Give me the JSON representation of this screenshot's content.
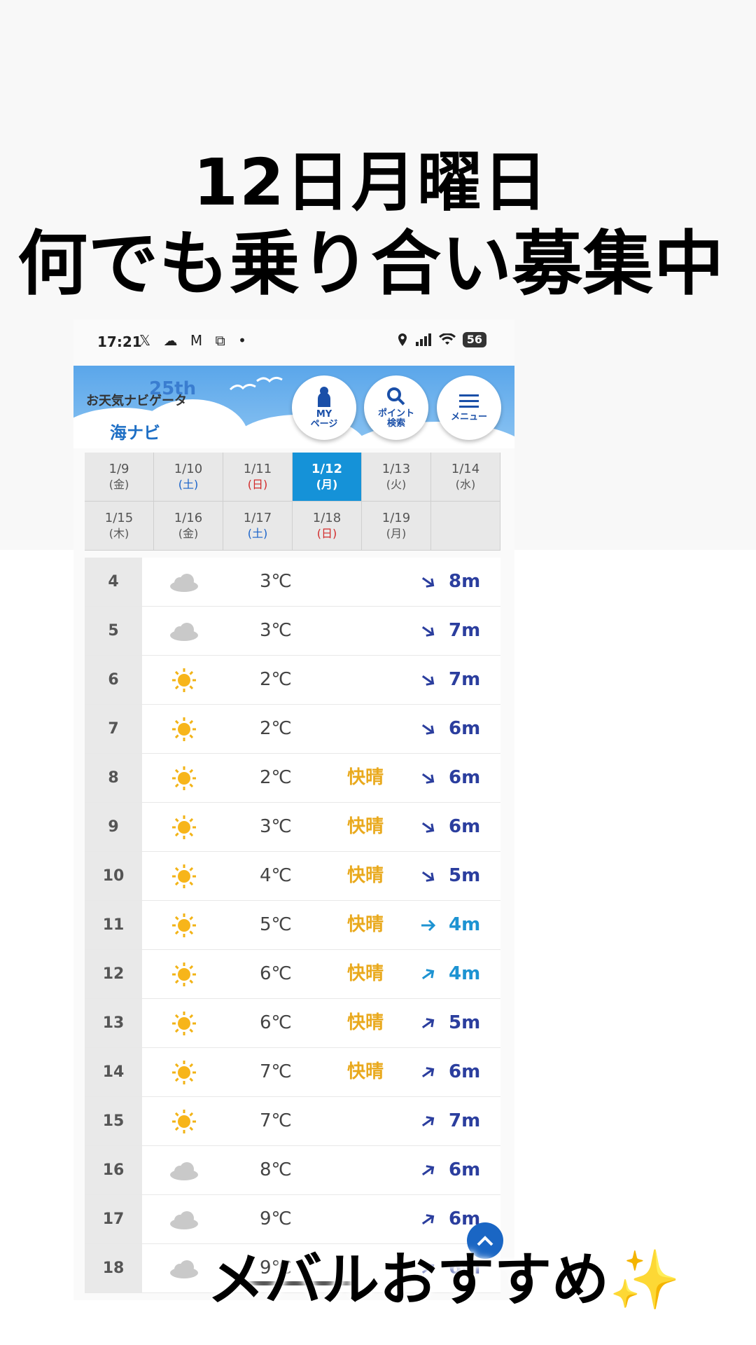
{
  "headline": {
    "line1": "12日月曜日",
    "line2": "何でも乗り合い募集中"
  },
  "statusbar": {
    "time": "17:21",
    "left_icons": "𝕏 ☁ M ⧉ •",
    "battery": "56"
  },
  "header": {
    "logo_small": "お天気ナビゲータ",
    "logo_25": "25th",
    "logo_main": "海ナビ",
    "buttons": [
      {
        "label_line1": "MY",
        "label_line2": "ページ",
        "icon": "person-icon"
      },
      {
        "label_line1": "ポイント",
        "label_line2": "検索",
        "icon": "search-icon"
      },
      {
        "label_line1": "メニュー",
        "label_line2": "",
        "icon": "menu-icon"
      }
    ]
  },
  "dates": [
    {
      "date": "1/9",
      "dow": "(金)",
      "kind": "weekday"
    },
    {
      "date": "1/10",
      "dow": "(土)",
      "kind": "sat"
    },
    {
      "date": "1/11",
      "dow": "(日)",
      "kind": "sun"
    },
    {
      "date": "1/12",
      "dow": "(月)",
      "kind": "selected"
    },
    {
      "date": "1/13",
      "dow": "(火)",
      "kind": "weekday"
    },
    {
      "date": "1/14",
      "dow": "(水)",
      "kind": "weekday"
    },
    {
      "date": "1/15",
      "dow": "(木)",
      "kind": "weekday"
    },
    {
      "date": "1/16",
      "dow": "(金)",
      "kind": "weekday"
    },
    {
      "date": "1/17",
      "dow": "(土)",
      "kind": "sat"
    },
    {
      "date": "1/18",
      "dow": "(日)",
      "kind": "sun"
    },
    {
      "date": "1/19",
      "dow": "(月)",
      "kind": "weekday"
    },
    {
      "date": "",
      "dow": "",
      "kind": "empty"
    }
  ],
  "forecast": [
    {
      "hour": "4",
      "weather": "cloud",
      "temp": "3℃",
      "note": "",
      "wind_dir": "southeast",
      "wind": "8m",
      "wind_color": "#2b3e9e"
    },
    {
      "hour": "5",
      "weather": "cloud",
      "temp": "3℃",
      "note": "",
      "wind_dir": "southeast",
      "wind": "7m",
      "wind_color": "#2b3e9e"
    },
    {
      "hour": "6",
      "weather": "sun",
      "temp": "2℃",
      "note": "",
      "wind_dir": "southeast",
      "wind": "7m",
      "wind_color": "#2b3e9e"
    },
    {
      "hour": "7",
      "weather": "sun",
      "temp": "2℃",
      "note": "",
      "wind_dir": "southeast",
      "wind": "6m",
      "wind_color": "#2b3e9e"
    },
    {
      "hour": "8",
      "weather": "sun",
      "temp": "2℃",
      "note": "快晴",
      "wind_dir": "southeast",
      "wind": "6m",
      "wind_color": "#2b3e9e"
    },
    {
      "hour": "9",
      "weather": "sun",
      "temp": "3℃",
      "note": "快晴",
      "wind_dir": "southeast",
      "wind": "6m",
      "wind_color": "#2b3e9e"
    },
    {
      "hour": "10",
      "weather": "sun",
      "temp": "4℃",
      "note": "快晴",
      "wind_dir": "southeast",
      "wind": "5m",
      "wind_color": "#2b3e9e"
    },
    {
      "hour": "11",
      "weather": "sun",
      "temp": "5℃",
      "note": "快晴",
      "wind_dir": "east",
      "wind": "4m",
      "wind_color": "#1d93d2"
    },
    {
      "hour": "12",
      "weather": "sun",
      "temp": "6℃",
      "note": "快晴",
      "wind_dir": "northeast",
      "wind": "4m",
      "wind_color": "#1d93d2"
    },
    {
      "hour": "13",
      "weather": "sun",
      "temp": "6℃",
      "note": "快晴",
      "wind_dir": "northeast",
      "wind": "5m",
      "wind_color": "#2b3e9e"
    },
    {
      "hour": "14",
      "weather": "sun",
      "temp": "7℃",
      "note": "快晴",
      "wind_dir": "northeast",
      "wind": "6m",
      "wind_color": "#2b3e9e"
    },
    {
      "hour": "15",
      "weather": "sun",
      "temp": "7℃",
      "note": "",
      "wind_dir": "northeast",
      "wind": "7m",
      "wind_color": "#2b3e9e"
    },
    {
      "hour": "16",
      "weather": "cloud",
      "temp": "8℃",
      "note": "",
      "wind_dir": "northeast",
      "wind": "6m",
      "wind_color": "#2b3e9e"
    },
    {
      "hour": "17",
      "weather": "cloud",
      "temp": "9℃",
      "note": "",
      "wind_dir": "northeast",
      "wind": "6m",
      "wind_color": "#2b3e9e"
    },
    {
      "hour": "18",
      "weather": "cloud",
      "temp": "9℃",
      "note": "",
      "wind_dir": "northeast",
      "wind": "6m",
      "wind_color": "#2b3e9e"
    }
  ],
  "caption": "メバルおすすめ✨",
  "colors": {
    "accent_blue": "#1592d8",
    "note_yellow": "#e9a91d",
    "wind_navy": "#2b3e9e",
    "wind_light": "#1d93d2"
  }
}
